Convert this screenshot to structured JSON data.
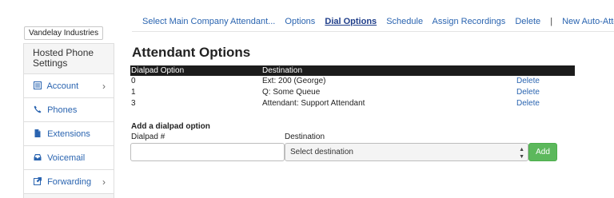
{
  "topnav": {
    "items": [
      {
        "label": "Select Main Company Attendant..."
      },
      {
        "label": "Options"
      },
      {
        "label": "Dial Options"
      },
      {
        "label": "Schedule"
      },
      {
        "label": "Assign Recordings"
      },
      {
        "label": "Delete"
      },
      {
        "label": "New Auto-Attendant"
      }
    ],
    "active_index": 2,
    "separator": "|"
  },
  "company": "Vandelay Industries",
  "sidebar": {
    "header": "Hosted Phone Settings",
    "items": [
      {
        "label": "Account",
        "icon": "list-icon",
        "has_chevron": true
      },
      {
        "label": "Phones",
        "icon": "phone-icon",
        "has_chevron": false
      },
      {
        "label": "Extensions",
        "icon": "document-icon",
        "has_chevron": false
      },
      {
        "label": "Voicemail",
        "icon": "inbox-icon",
        "has_chevron": false
      },
      {
        "label": "Forwarding",
        "icon": "share-icon",
        "has_chevron": true
      }
    ]
  },
  "main": {
    "title": "Attendant Options",
    "table": {
      "headers": [
        "Dialpad Option",
        "Destination",
        ""
      ],
      "rows": [
        {
          "option": "0",
          "destination": "Ext: 200 (George)",
          "action": "Delete"
        },
        {
          "option": "1",
          "destination": "Q: Some Queue",
          "action": "Delete"
        },
        {
          "option": "3",
          "destination": "Attendant: Support Attendant",
          "action": "Delete"
        }
      ]
    },
    "add_form": {
      "title": "Add a dialpad option",
      "dialpad_label": "Dialpad #",
      "dialpad_value": "",
      "destination_label": "Destination",
      "destination_selected": "Select destination",
      "add_button": "Add"
    }
  },
  "colors": {
    "link": "#2a64b0",
    "table_header_bg": "#1c1c1c",
    "add_button": "#5cb85c"
  }
}
